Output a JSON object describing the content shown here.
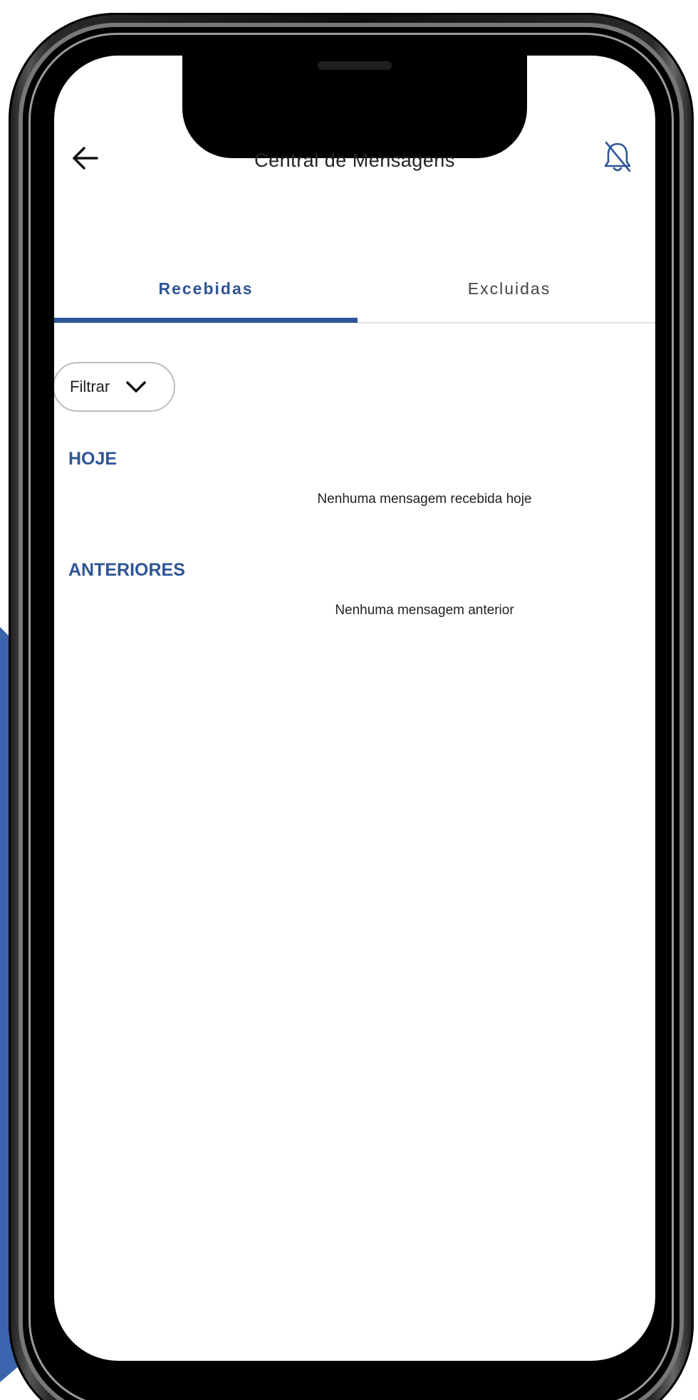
{
  "header": {
    "title": "Central de Mensagens",
    "back_icon": "arrow-left-icon",
    "notification_icon": "bell-off-icon"
  },
  "tabs": [
    {
      "label": "Recebidas",
      "active": true
    },
    {
      "label": "Excluidas",
      "active": false
    }
  ],
  "filter": {
    "label": "Filtrar",
    "icon": "chevron-down-icon"
  },
  "sections": [
    {
      "title": "HOJE",
      "empty_message": "Nenhuma mensagem recebida hoje"
    },
    {
      "title": "ANTERIORES",
      "empty_message": "Nenhuma mensagem anterior"
    }
  ],
  "colors": {
    "accent": "#2e5596",
    "backdrop_blue": "#3a64ad"
  }
}
